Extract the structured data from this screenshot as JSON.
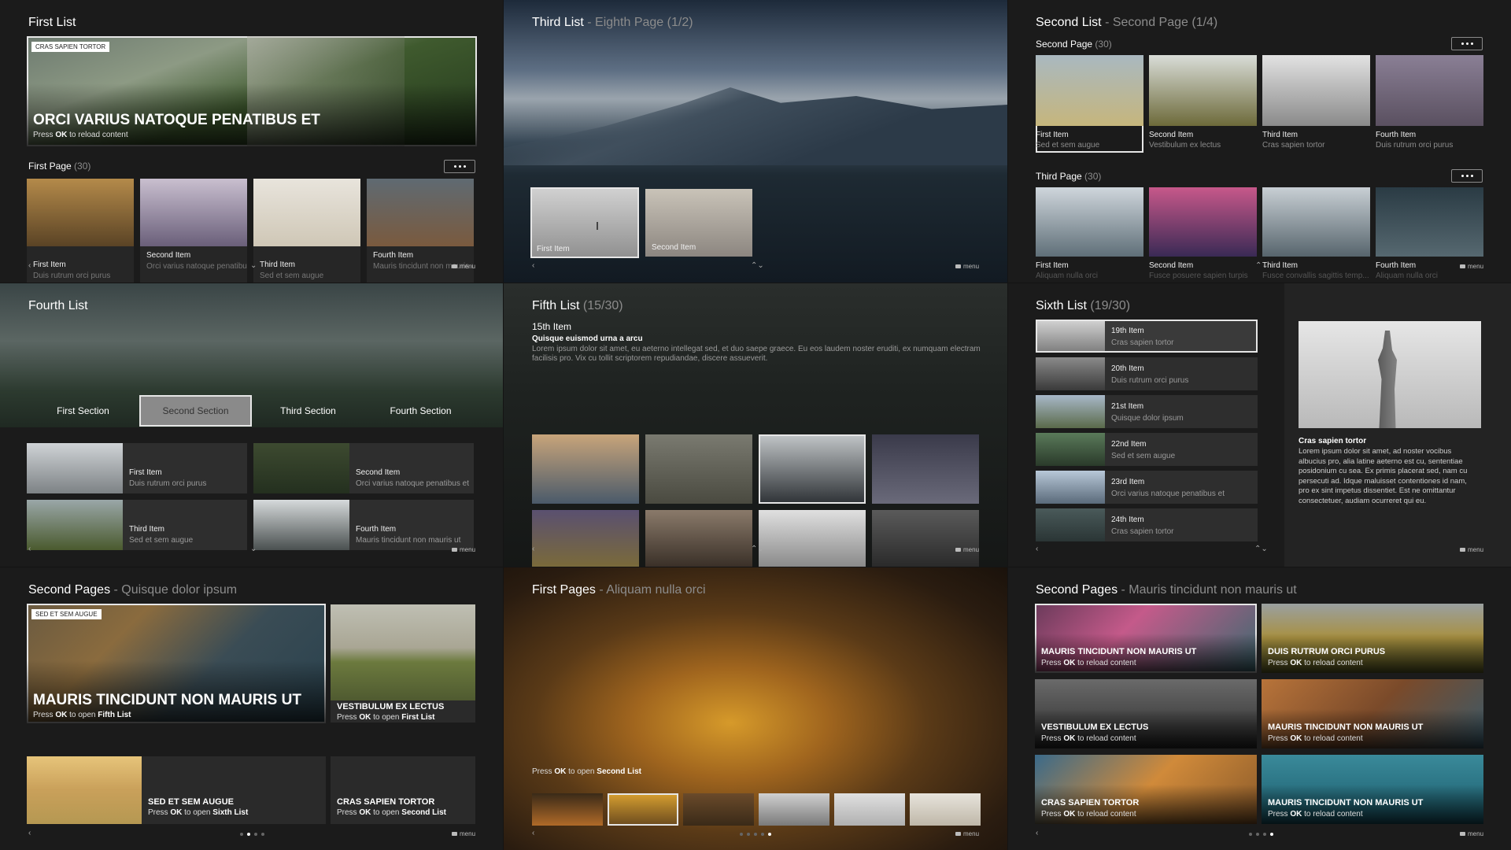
{
  "menu_label": "menu",
  "p1": {
    "title": "First List",
    "hero": {
      "badge": "CRAS SAPIEN TORTOR",
      "title": "ORCI VARIUS NATOQUE PENATIBUS ET",
      "press_pre": "Press",
      "press_key": "OK",
      "press_post": "to reload content"
    },
    "section": {
      "label": "First Page",
      "count": "(30)"
    },
    "items": [
      {
        "label": "First Item",
        "sub": "Duis rutrum orci purus"
      },
      {
        "label": "Second Item",
        "sub": "Orci varius natoque penatibus et"
      },
      {
        "label": "Third Item",
        "sub": "Sed et sem augue"
      },
      {
        "label": "Fourth Item",
        "sub": "Mauris tincidunt non mauris ut"
      }
    ]
  },
  "p2": {
    "title": "Third List",
    "sub": "- Eighth Page (1/2)",
    "items": [
      {
        "label": "First Item"
      },
      {
        "label": "Second Item"
      }
    ]
  },
  "p3": {
    "title": "Second List",
    "sub": "- Second Page (1/4)",
    "sections": [
      {
        "label": "Second Page",
        "count": "(30)",
        "items": [
          {
            "label": "First Item",
            "sub": "Sed et sem augue"
          },
          {
            "label": "Second Item",
            "sub": "Vestibulum ex lectus"
          },
          {
            "label": "Third Item",
            "sub": "Cras sapien tortor"
          },
          {
            "label": "Fourth Item",
            "sub": "Duis rutrum orci purus"
          }
        ]
      },
      {
        "label": "Third Page",
        "count": "(30)",
        "items": [
          {
            "label": "First Item",
            "sub": "Aliquam nulla orci"
          },
          {
            "label": "Second Item",
            "sub": "Fusce posuere sapien turpis"
          },
          {
            "label": "Third Item",
            "sub": "Fusce convallis sagittis temp..."
          },
          {
            "label": "Fourth Item",
            "sub": "Aliquam nulla orci"
          }
        ]
      }
    ]
  },
  "p4": {
    "title": "Fourth List",
    "tabs": [
      "First Section",
      "Second Section",
      "Third Section",
      "Fourth Section"
    ],
    "items": [
      {
        "label": "First Item",
        "sub": "Duis rutrum orci purus"
      },
      {
        "label": "Second Item",
        "sub": "Orci varius natoque penatibus et"
      },
      {
        "label": "Third Item",
        "sub": "Sed et sem augue"
      },
      {
        "label": "Fourth Item",
        "sub": "Mauris tincidunt non mauris ut"
      }
    ]
  },
  "p5": {
    "title": "Fifth List",
    "sub": "(15/30)",
    "item_title": "15th Item",
    "item_sub": "Quisque euismod urna a arcu",
    "desc": "Lorem ipsum dolor sit amet, eu aeterno intellegat sed, et duo saepe graece. Eu eos laudem noster eruditi, ex numquam electram facilisis pro. Vix cu tollit scriptorem repudiandae, discere assueverit."
  },
  "p6": {
    "title": "Sixth List",
    "sub": "(19/30)",
    "items": [
      {
        "label": "19th Item",
        "sub": "Cras sapien tortor"
      },
      {
        "label": "20th Item",
        "sub": "Duis rutrum orci purus"
      },
      {
        "label": "21st Item",
        "sub": "Quisque dolor ipsum"
      },
      {
        "label": "22nd Item",
        "sub": "Sed et sem augue"
      },
      {
        "label": "23rd Item",
        "sub": "Orci varius natoque penatibus et"
      },
      {
        "label": "24th Item",
        "sub": "Cras sapien tortor"
      }
    ],
    "detail_title": "Cras sapien tortor",
    "detail_text": "Lorem ipsum dolor sit amet, ad noster vocibus albucius pro, alia latine aeterno est cu, sententiae posidonium cu sea. Ex primis placerat sed, nam cu persecuti ad. Idque maluisset contentiones id nam, pro ex sint impetus dissentiet. Est ne omittantur consectetuer, audiam ocurreret qui eu."
  },
  "p7": {
    "title": "Second Pages",
    "sub": "- Quisque dolor ipsum",
    "tiles": [
      {
        "badge": "SED ET SEM AUGUE",
        "title": "MAURIS TINCIDUNT NON MAURIS UT",
        "press": "Press",
        "key": "OK",
        "mid": "to open",
        "target": "Fifth List"
      },
      {
        "title": "VESTIBULUM EX LECTUS",
        "press": "Press",
        "key": "OK",
        "mid": "to open",
        "target": "First List"
      },
      {
        "title": "SED ET SEM AUGUE",
        "press": "Press",
        "key": "OK",
        "mid": "to open",
        "target": "Sixth List"
      },
      {
        "title": "CRAS SAPIEN TORTOR",
        "press": "Press",
        "key": "OK",
        "mid": "to open",
        "target": "Second List"
      }
    ]
  },
  "p8": {
    "title": "First Pages",
    "sub": "- Aliquam nulla orci",
    "press": "Press",
    "key": "OK",
    "mid": "to open",
    "target": "Second List"
  },
  "p9": {
    "title": "Second Pages",
    "sub": "- Mauris tincidunt non mauris ut",
    "tiles": [
      {
        "title": "MAURIS TINCIDUNT NON MAURIS UT"
      },
      {
        "title": "DUIS RUTRUM ORCI PURUS"
      },
      {
        "title": "VESTIBULUM EX LECTUS"
      },
      {
        "title": "MAURIS TINCIDUNT NON MAURIS UT"
      },
      {
        "title": "CRAS SAPIEN TORTOR"
      },
      {
        "title": "MAURIS TINCIDUNT NON MAURIS UT"
      }
    ],
    "press": "Press",
    "key": "OK",
    "post": "to reload content"
  }
}
